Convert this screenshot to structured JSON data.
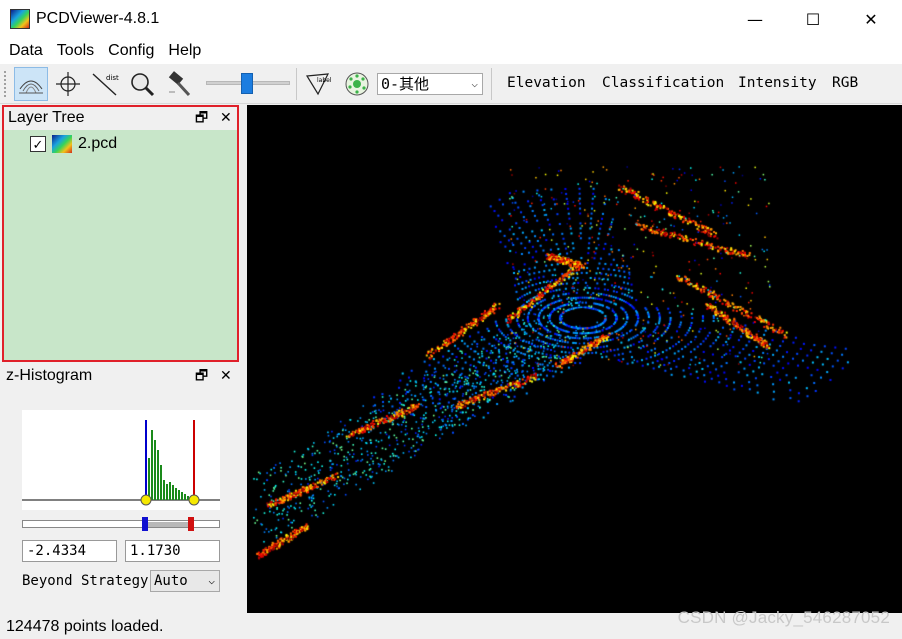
{
  "window": {
    "title": "PCDViewer-4.8.1",
    "minimize": "—",
    "maximize": "☐",
    "close": "✕"
  },
  "menu": [
    "Data",
    "Tools",
    "Config",
    "Help"
  ],
  "toolbar": {
    "class_combo": "0-其他",
    "dist_label": "dist",
    "label_label": "label",
    "modes": [
      "Elevation",
      "Classification",
      "Intensity",
      "RGB"
    ]
  },
  "layer_tree": {
    "title": "Layer Tree",
    "items": [
      {
        "label": "2.pcd",
        "checked": true
      }
    ]
  },
  "histogram": {
    "title": "z-Histogram",
    "min_value": "-2.4334",
    "max_value": "1.1730",
    "beyond_label": "Beyond Strategy",
    "beyond_option": "Auto"
  },
  "status": "124478 points loaded.",
  "watermark": "CSDN @Jacky_546287052"
}
